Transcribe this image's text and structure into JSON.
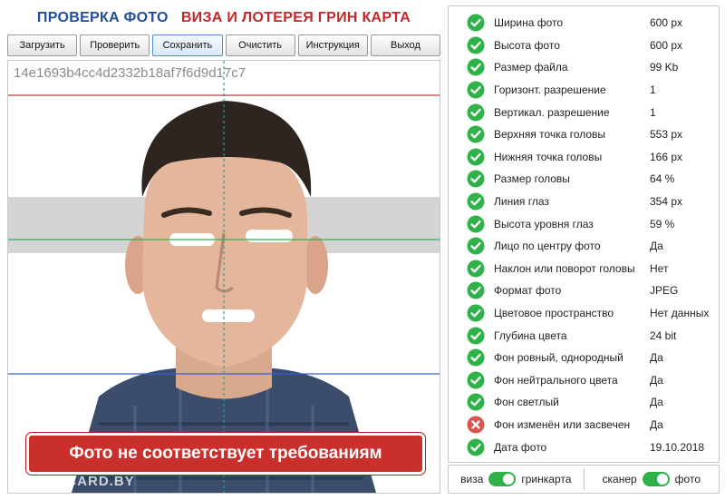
{
  "header": {
    "title_left": "ПРОВЕРКА ФОТО",
    "title_right": "ВИЗА И ЛОТЕРЕЯ ГРИН КАРТА"
  },
  "toolbar": {
    "buttons": [
      {
        "label": "Загрузить"
      },
      {
        "label": "Проверить"
      },
      {
        "label": "Сохранить",
        "active": true
      },
      {
        "label": "Очистить"
      },
      {
        "label": "Инструкция"
      },
      {
        "label": "Выход"
      }
    ]
  },
  "photo": {
    "hash": "14e1693b4cc4d2332b18af7f6d9d17c7",
    "verdict": "Фото не соответствует требованиям",
    "watermark": "GREENCARD.BY"
  },
  "checks": [
    {
      "label": "Ширина фото",
      "value": "600 px",
      "status": "ok"
    },
    {
      "label": "Высота фото",
      "value": "600 px",
      "status": "ok"
    },
    {
      "label": "Размер файла",
      "value": "99 Kb",
      "status": "ok"
    },
    {
      "label": "Горизонт. разрешение",
      "value": "1",
      "status": "ok"
    },
    {
      "label": "Вертикал. разрешение",
      "value": "1",
      "status": "ok"
    },
    {
      "label": "Верхняя точка головы",
      "value": "553 px",
      "status": "ok"
    },
    {
      "label": "Нижняя точка головы",
      "value": "166 px",
      "status": "ok"
    },
    {
      "label": "Размер головы",
      "value": "64 %",
      "status": "ok"
    },
    {
      "label": "Линия глаз",
      "value": "354 px",
      "status": "ok"
    },
    {
      "label": "Высота уровня глаз",
      "value": "59 %",
      "status": "ok"
    },
    {
      "label": "Лицо по центру фото",
      "value": "Да",
      "status": "ok"
    },
    {
      "label": "Наклон или поворот головы",
      "value": "Нет",
      "status": "ok"
    },
    {
      "label": "Формат фото",
      "value": "JPEG",
      "status": "ok"
    },
    {
      "label": "Цветовое пространство",
      "value": "Нет данных",
      "status": "ok"
    },
    {
      "label": "Глубина цвета",
      "value": "24 bit",
      "status": "ok"
    },
    {
      "label": "Фон ровный, однородный",
      "value": "Да",
      "status": "ok"
    },
    {
      "label": "Фон нейтрального цвета",
      "value": "Да",
      "status": "ok"
    },
    {
      "label": "Фон светлый",
      "value": "Да",
      "status": "ok"
    },
    {
      "label": "Фон изменён или засвечен",
      "value": "Да",
      "status": "fail"
    },
    {
      "label": "Дата фото",
      "value": "19.10.2018",
      "status": "ok"
    }
  ],
  "switches": {
    "mode": {
      "left": "виза",
      "right": "гринкарта",
      "on": true
    },
    "source": {
      "left": "сканер",
      "right": "фото",
      "on": true
    }
  },
  "colors": {
    "title_blue": "#1f4e9c",
    "title_red": "#c0282a",
    "ok_green": "#2fb24a",
    "fail_red": "#d9534f",
    "verdict_red": "#c9302c"
  },
  "icons": {
    "ok": "check-circle-icon",
    "fail": "cross-circle-icon"
  }
}
